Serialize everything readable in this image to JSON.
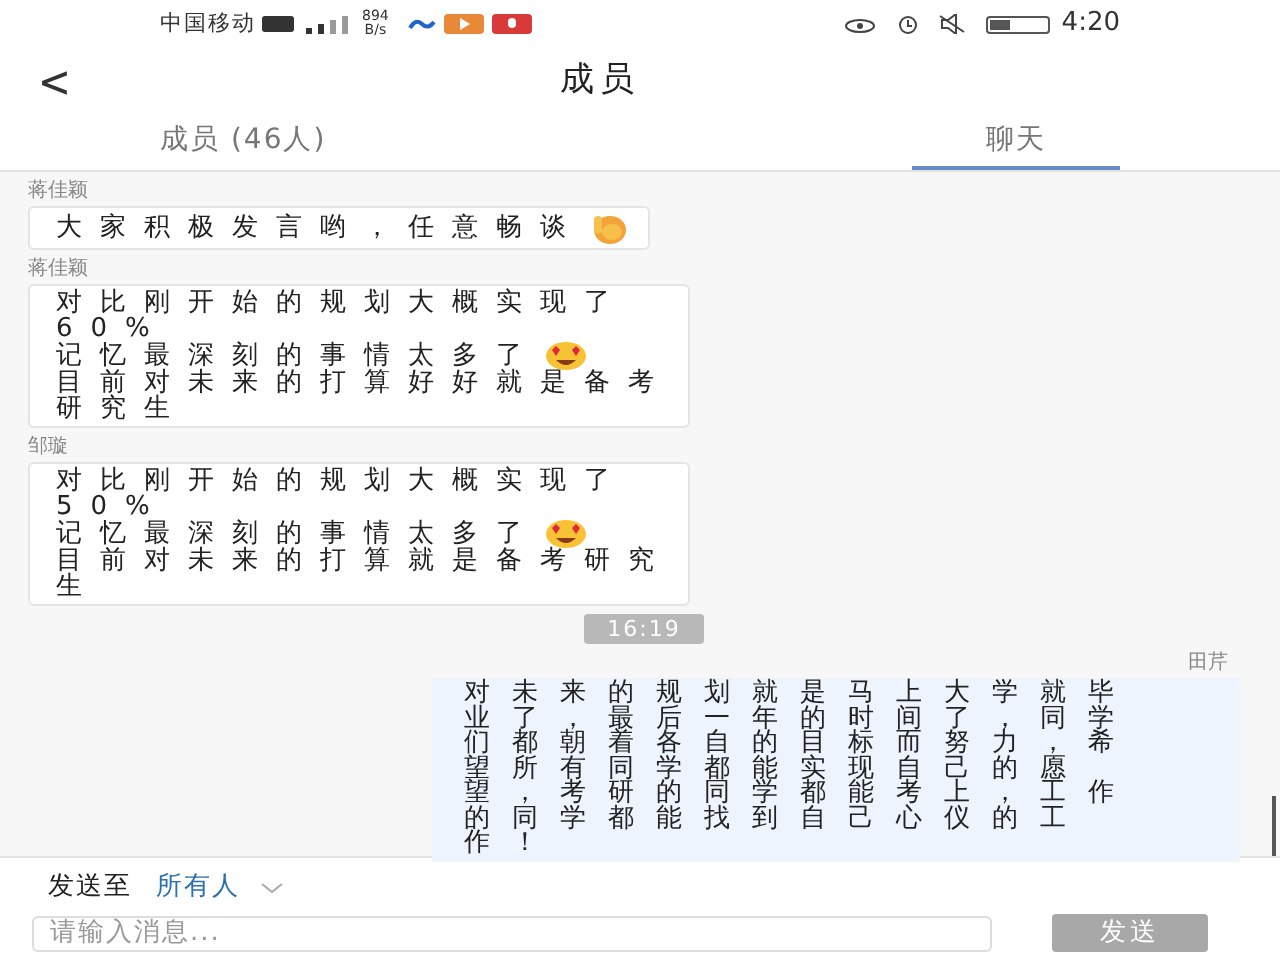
{
  "status_bar": {
    "carrier": "中国移动",
    "net_speed": [
      "894",
      "B/s"
    ],
    "time": "4:20"
  },
  "header": {
    "back": "<",
    "title": "成员"
  },
  "tabs": [
    {
      "label": "成员 (46人)",
      "selected": false
    },
    {
      "label": "聊天",
      "selected": true
    }
  ],
  "messages": [
    {
      "kind": "incoming",
      "sender": "蒋佳颖",
      "lines": [
        {
          "text": "大家积极发言哟，任意畅谈",
          "kind": "hand"
        }
      ]
    },
    {
      "kind": "incoming",
      "sender": "蒋佳颖",
      "lines": [
        {
          "text": "对比刚开始的规划大概实现了"
        },
        {
          "text": "60%"
        },
        {
          "text": "记忆最深刻的事情太多了",
          "kind": "hearteyes"
        },
        {
          "text": "目前对未来的打算好好就是备考"
        },
        {
          "text": "研究生"
        }
      ]
    },
    {
      "kind": "incoming",
      "sender": "邹璇",
      "lines": [
        {
          "text": "对比刚开始的规划大概实现了"
        },
        {
          "text": "50%"
        },
        {
          "text": "记忆最深刻的事情太多了",
          "kind": "hearteyes"
        },
        {
          "text": "目前对未来的打算就是备考研究"
        },
        {
          "text": "生"
        }
      ]
    },
    {
      "kind": "time",
      "text": "16:19"
    },
    {
      "kind": "outgoing",
      "sender": "田芹",
      "lines": [
        {
          "text": "对未来的规划就是马上大学就毕"
        },
        {
          "text": "业了，最后一年的时间了，同学"
        },
        {
          "text": "们都朝着各自的目标而努力，希"
        },
        {
          "text": "望所有同学都能实现自己的愿"
        },
        {
          "text": "望，考研的同学都能考上，工作"
        },
        {
          "text": "的同学都能找到自己心仪的工"
        },
        {
          "text": "作！"
        }
      ]
    }
  ],
  "composer": {
    "send_to_label": "发送至",
    "recipient": "所有人",
    "placeholder": "请输入消息...",
    "send_button": "发送",
    "send_enabled": false
  }
}
